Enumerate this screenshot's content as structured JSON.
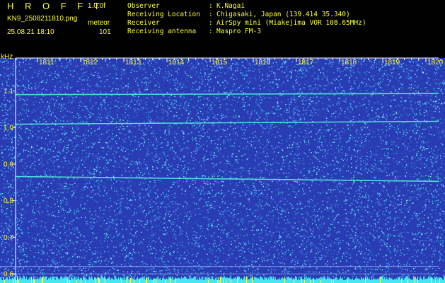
{
  "header": {
    "app_name": "H R O F F T",
    "version": "1.0.0f",
    "filename": "KN9_2508211810.png",
    "tag": "meteor",
    "datetime": "25.08.21 18:10",
    "count": "101",
    "info": [
      {
        "label": "Observer",
        "value": "K.Nagai"
      },
      {
        "label": "Receiving Location",
        "value": "Chigasaki, Japan (139.414 35.340)"
      },
      {
        "label": "Receiver",
        "value": "AirSpy mini (Miakejima VOR 108.65MHz)"
      },
      {
        "label": "Receiving antenna",
        "value": "Maspro FM-3"
      }
    ]
  },
  "colors": {
    "text": "#ffff33",
    "background": "#2a3cb4",
    "noise": "#46d2f0",
    "trace": "#4fe6d8",
    "axis": "#ffffff"
  },
  "chart_data": {
    "type": "heatmap",
    "title": "",
    "xlabel": "",
    "ylabel": "kHz",
    "x_ticks": [
      "1811",
      "1812",
      "1813",
      "1814",
      "1815",
      "1816",
      "1817",
      "1818",
      "1819",
      "1820"
    ],
    "y_ticks": [
      1.1,
      1.0,
      0.9,
      0.8,
      0.7,
      0.6
    ],
    "y_tick_labels": [
      "1.1",
      "1.0",
      "0.9",
      "0.8",
      "0.7",
      "0.6"
    ],
    "ylim": [
      0.575,
      1.19
    ],
    "series": [
      {
        "y_start": 1.09,
        "y_end": 1.093
      },
      {
        "y_start": 1.009,
        "y_end": 1.017
      },
      {
        "y_start": 0.866,
        "y_end": 0.853
      },
      {
        "y_start": 0.62,
        "y_end": 0.62
      },
      {
        "y_start": 0.6,
        "y_end": 0.6
      }
    ]
  }
}
